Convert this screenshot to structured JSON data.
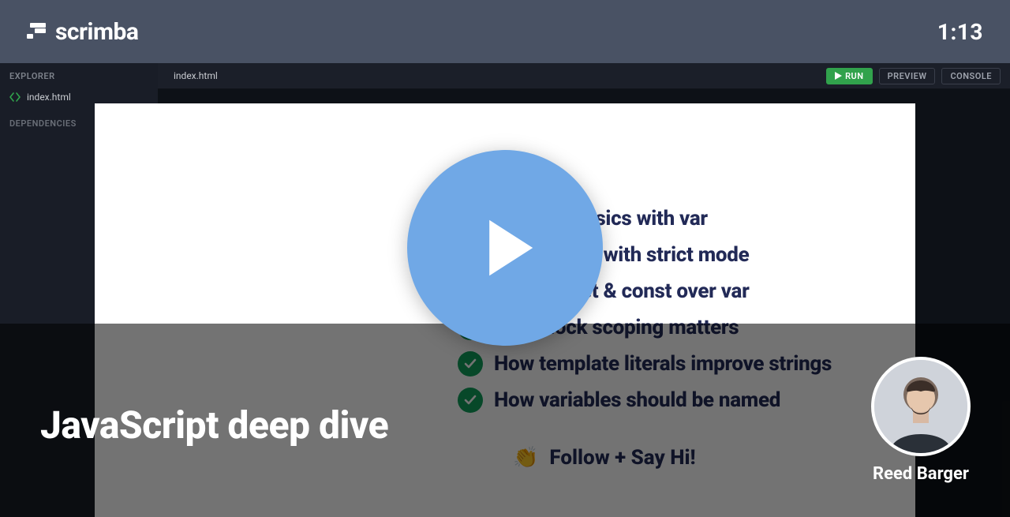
{
  "brand": {
    "name": "scrimba"
  },
  "header": {
    "timestamp": "1:13"
  },
  "sidebar": {
    "explorer_label": "EXPLORER",
    "dependencies_label": "DEPENDENCIES",
    "files": [
      {
        "name": "index.html"
      }
    ]
  },
  "tabs": {
    "active_file": "index.html"
  },
  "actions": {
    "run_label": "RUN",
    "preview_label": "PREVIEW",
    "console_label": "CONSOLE"
  },
  "slide": {
    "items": [
      "Variable basics with var",
      "Better code with strict mode",
      "Why use let & const over var",
      "Why block scoping matters",
      "How template literals improve strings",
      "How variables should be named"
    ],
    "follow_emoji": "👏",
    "follow_text": "Follow + Say Hi!"
  },
  "course": {
    "title": "JavaScript deep dive",
    "author": "Reed Barger"
  }
}
